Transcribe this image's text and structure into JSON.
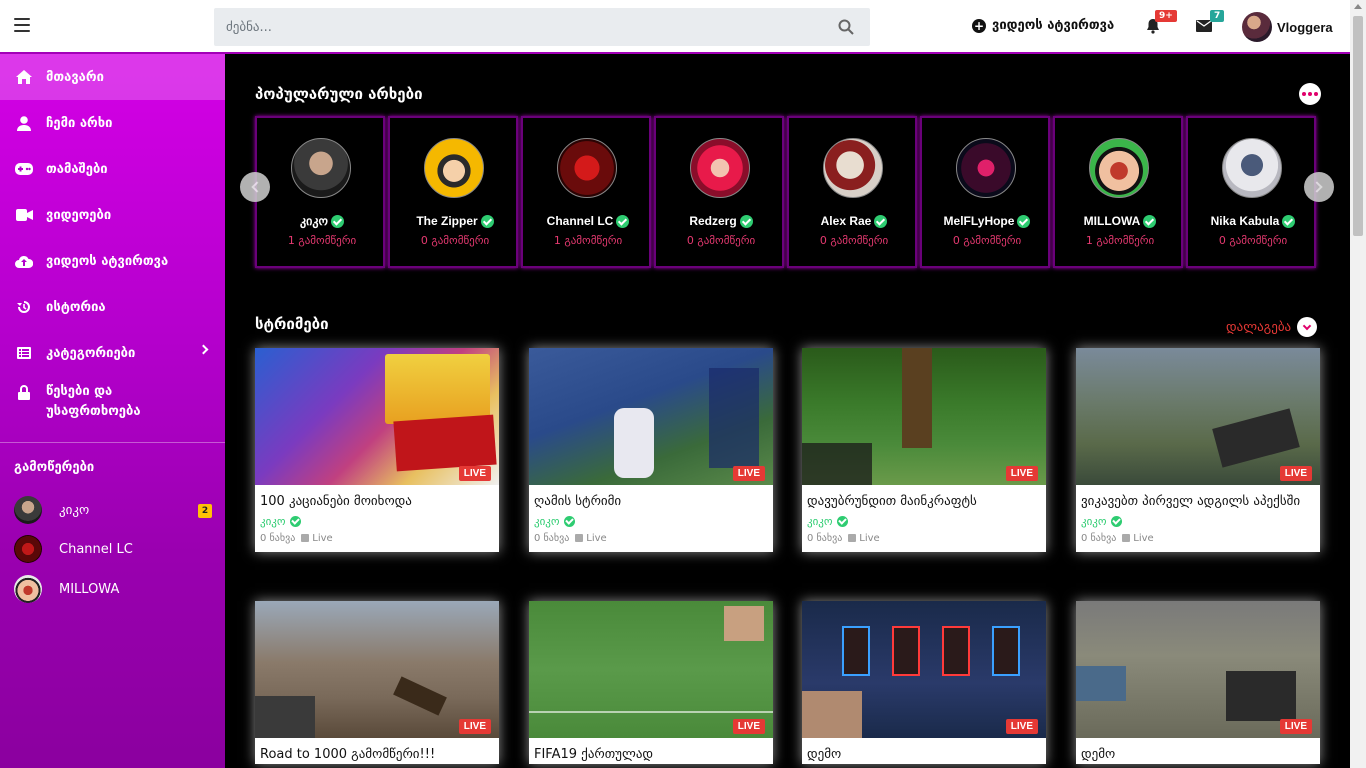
{
  "header": {
    "search_placeholder": "ძებნა...",
    "upload_label": "ვიდეოს ატვირთვა",
    "notifications_badge": "9+",
    "messages_badge": "7",
    "username": "Vloggera"
  },
  "sidebar": {
    "items": [
      {
        "label": "მთავარი",
        "icon": "home-icon"
      },
      {
        "label": "ჩემი არხი",
        "icon": "user-icon"
      },
      {
        "label": "თამაშები",
        "icon": "gamepad-icon"
      },
      {
        "label": "ვიდეოები",
        "icon": "video-icon"
      },
      {
        "label": "ვიდეოს ატვირთვა",
        "icon": "upload-icon"
      },
      {
        "label": "ისტორია",
        "icon": "history-icon"
      },
      {
        "label": "კატეგორიები",
        "icon": "list-icon"
      },
      {
        "label": "წესები და უსაფრთხოება",
        "icon": "lock-icon"
      }
    ],
    "subscriptions_title": "გამოწერები",
    "subscriptions": [
      {
        "name": "კიკო",
        "badge": "2"
      },
      {
        "name": "Channel LC",
        "badge": ""
      },
      {
        "name": "MILLOWA",
        "badge": ""
      }
    ]
  },
  "popular": {
    "title": "პოპულარული არხები",
    "channels": [
      {
        "name": "კიკო",
        "subs": "1 გამომწერი"
      },
      {
        "name": "The Zipper",
        "subs": "0 გამომწერი"
      },
      {
        "name": "Channel LC",
        "subs": "1 გამომწერი"
      },
      {
        "name": "Redzerg",
        "subs": "0 გამომწერი"
      },
      {
        "name": "Alex Rae",
        "subs": "0 გამომწერი"
      },
      {
        "name": "MelFLyHope",
        "subs": "0 გამომწერი"
      },
      {
        "name": "MILLOWA",
        "subs": "1 გამომწერი"
      },
      {
        "name": "Nika Kabula",
        "subs": "0 გამომწერი"
      }
    ]
  },
  "streams": {
    "title": "სტრიმები",
    "sort_label": "დალაგება",
    "live_label": "LIVE",
    "items": [
      {
        "title": "100 კაციანები მოიხოდა",
        "author": "კიკო",
        "views": "0 ნახვა",
        "status": "Live"
      },
      {
        "title": "ღამის სტრიმი",
        "author": "კიკო",
        "views": "0 ნახვა",
        "status": "Live"
      },
      {
        "title": "დავუბრუნდით მაინკრაფტს",
        "author": "კიკო",
        "views": "0 ნახვა",
        "status": "Live"
      },
      {
        "title": "ვიკავებთ პირველ ადგილს აპექსში",
        "author": "კიკო",
        "views": "0 ნახვა",
        "status": "Live"
      },
      {
        "title": "Road to 1000 გამომწერი!!!",
        "author": "",
        "views": "",
        "status": ""
      },
      {
        "title": "FIFA19 ქართულად",
        "author": "",
        "views": "",
        "status": ""
      },
      {
        "title": "დემო",
        "author": "",
        "views": "",
        "status": ""
      },
      {
        "title": "დემო",
        "author": "",
        "views": "",
        "status": ""
      }
    ]
  },
  "colors": {
    "accent": "#c800dc",
    "live": "#e53935",
    "verified": "#2ecc71",
    "subscribers": "#e53970"
  }
}
